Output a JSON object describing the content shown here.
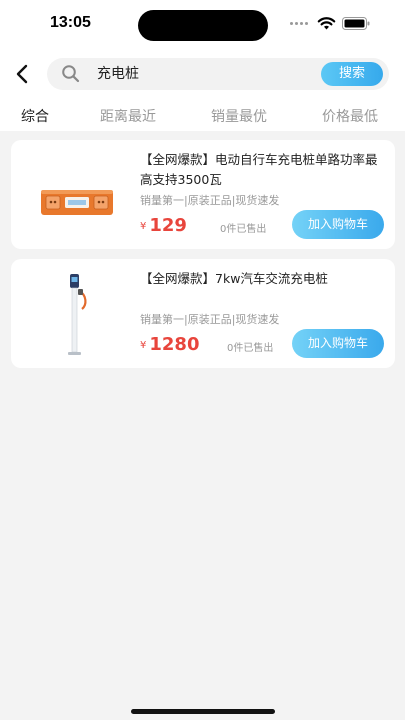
{
  "status_bar": {
    "time": "13:05"
  },
  "search": {
    "query": "充电桩",
    "button_label": "搜索"
  },
  "tabs": [
    {
      "label": "综合",
      "active": true
    },
    {
      "label": "距离最近",
      "active": false
    },
    {
      "label": "销量最优",
      "active": false
    },
    {
      "label": "价格最低",
      "active": false
    }
  ],
  "products": [
    {
      "title": "【全网爆款】电动自行车充电桩单路功率最高支持3500瓦",
      "tags": "销量第一|原装正品|现货速发",
      "currency": "¥",
      "price": "129",
      "sold": "0件已售出",
      "cart_label": "加入购物车"
    },
    {
      "title": "【全网爆款】7kw汽车交流充电桩",
      "tags": "销量第一|原装正品|现货速发",
      "currency": "¥",
      "price": "1280",
      "sold": "0件已售出",
      "cart_label": "加入购物车"
    }
  ],
  "colors": {
    "accent": "#3aa9ec",
    "price": "#e8453c"
  }
}
